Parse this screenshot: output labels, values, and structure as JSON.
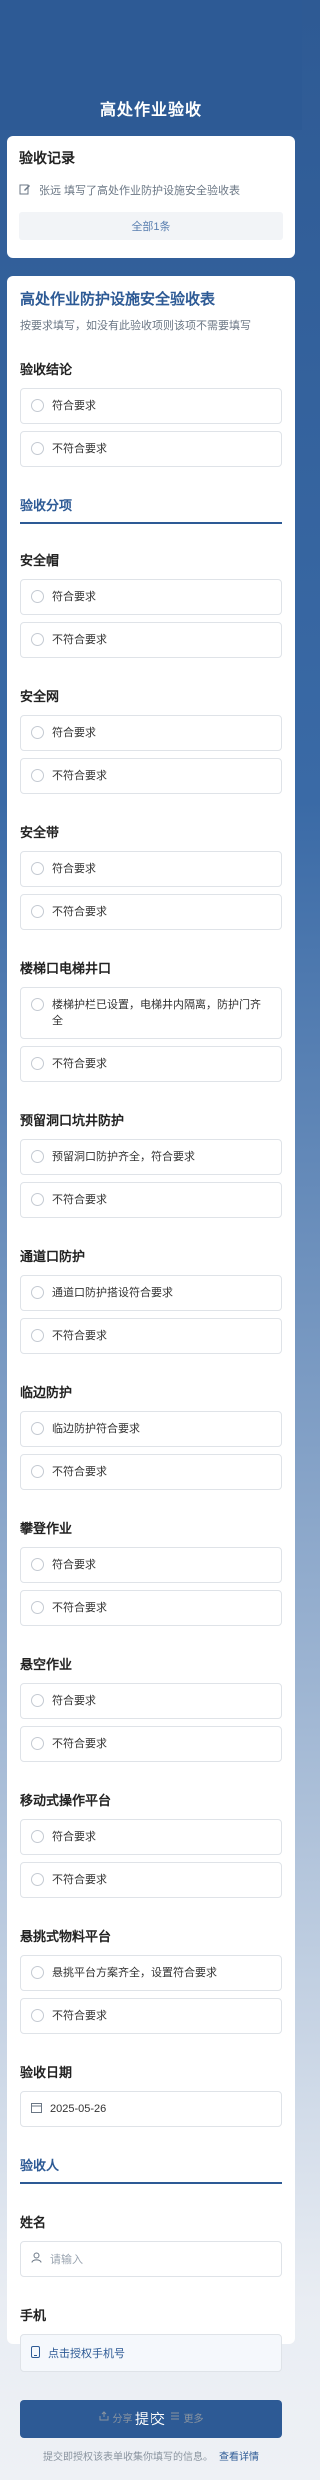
{
  "header": {
    "title": "高处作业验收"
  },
  "record": {
    "title": "验收记录",
    "entry": "张远 填写了高处作业防护设施安全验收表",
    "all_button": "全部1条"
  },
  "form": {
    "title": "高处作业防护设施安全验收表",
    "desc": "按要求填写，如没有此验收项则该项不需要填写",
    "conclusion": {
      "label": "验收结论",
      "options": [
        "符合要求",
        "不符合要求"
      ]
    },
    "section1": "验收分项",
    "items": [
      {
        "label": "安全帽",
        "ok": "符合要求",
        "bad": "不符合要求"
      },
      {
        "label": "安全网",
        "ok": "符合要求",
        "bad": "不符合要求"
      },
      {
        "label": "安全带",
        "ok": "符合要求",
        "bad": "不符合要求"
      },
      {
        "label": "楼梯口电梯井口",
        "ok": "楼梯护栏已设置，电梯井内隔离，防护门齐全",
        "bad": "不符合要求"
      },
      {
        "label": "预留洞口坑井防护",
        "ok": "预留洞口防护齐全，符合要求",
        "bad": "不符合要求"
      },
      {
        "label": "通道口防护",
        "ok": "通道口防护搭设符合要求",
        "bad": "不符合要求"
      },
      {
        "label": "临边防护",
        "ok": "临边防护符合要求",
        "bad": "不符合要求"
      },
      {
        "label": "攀登作业",
        "ok": "符合要求",
        "bad": "不符合要求"
      },
      {
        "label": "悬空作业",
        "ok": "符合要求",
        "bad": "不符合要求"
      },
      {
        "label": "移动式操作平台",
        "ok": "符合要求",
        "bad": "不符合要求"
      },
      {
        "label": "悬挑式物料平台",
        "ok": "悬挑平台方案齐全，设置符合要求",
        "bad": "不符合要求"
      }
    ],
    "date_label": "验收日期",
    "date_value": "2025-05-26",
    "section2": "验收人",
    "name_label": "姓名",
    "name_placeholder": "请输入",
    "phone_label": "手机",
    "phone_button": "点击授权手机号",
    "submit": "提交",
    "agree_text": "提交即授权该表单收集你填写的信息。",
    "agree_link": "查看详情"
  },
  "footer": {
    "share": "分享",
    "more": "更多"
  }
}
